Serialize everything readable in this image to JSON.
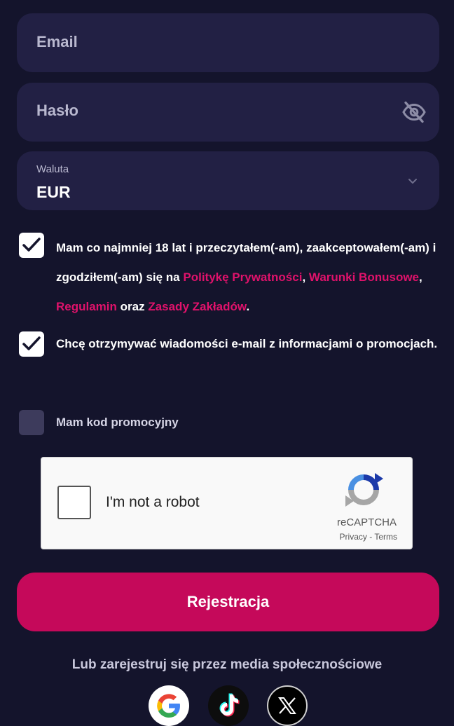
{
  "form": {
    "email_placeholder": "Email",
    "password_placeholder": "Hasło",
    "currency_label": "Waluta",
    "currency_value": "EUR"
  },
  "consents": [
    {
      "checked": true,
      "text_1": "Mam co najmniej 18 lat i przeczytałem(-am), zaakceptowałem(-am) i zgodziłem(-am) się na ",
      "link_privacy": "Politykę Prywatności",
      "sep_1": ", ",
      "link_bonus": "Warunki Bonusowe",
      "sep_2": ", ",
      "link_rules": "Regulamin",
      "sep_3": " oraz ",
      "link_betting": "Zasady Zakładów",
      "end": "."
    },
    {
      "checked": true,
      "text": "Chcę otrzymywać wiadomości e-mail z informacjami o promocjach."
    },
    {
      "checked": false,
      "text": "Mam kod promocyjny"
    }
  ],
  "recaptcha": {
    "label": "I'm not a robot",
    "brand": "reCAPTCHA",
    "links": "Privacy - Terms"
  },
  "register_button": "Rejestracja",
  "social": {
    "label": "Lub zarejestruj się przez media społecznościowe",
    "providers": [
      "google-icon",
      "tiktok-icon",
      "x-icon"
    ]
  },
  "colors": {
    "background": "#14142c",
    "field": "#222044",
    "accent": "#c5095a",
    "link": "#e0126b"
  }
}
